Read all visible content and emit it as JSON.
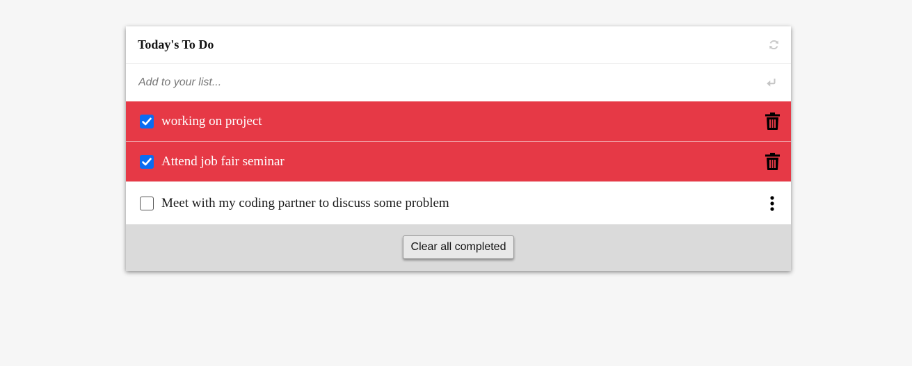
{
  "header": {
    "title": "Today's To Do",
    "refresh_icon": "refresh-icon"
  },
  "add": {
    "placeholder": "Add to your list...",
    "value": "",
    "enter_icon": "enter-icon"
  },
  "todos": [
    {
      "text": "working on project",
      "completed": true,
      "action_icon": "trash-icon"
    },
    {
      "text": "Attend job fair seminar",
      "completed": true,
      "action_icon": "trash-icon"
    },
    {
      "text": "Meet with my coding partner to discuss some problem",
      "completed": false,
      "action_icon": "more-vertical-icon"
    }
  ],
  "footer": {
    "clear_label": "Clear all completed"
  },
  "colors": {
    "completed_bg": "#e63946",
    "checkbox_accent": "#0b6cf2",
    "footer_bg": "#dadada",
    "page_bg": "#f6f6f6"
  }
}
